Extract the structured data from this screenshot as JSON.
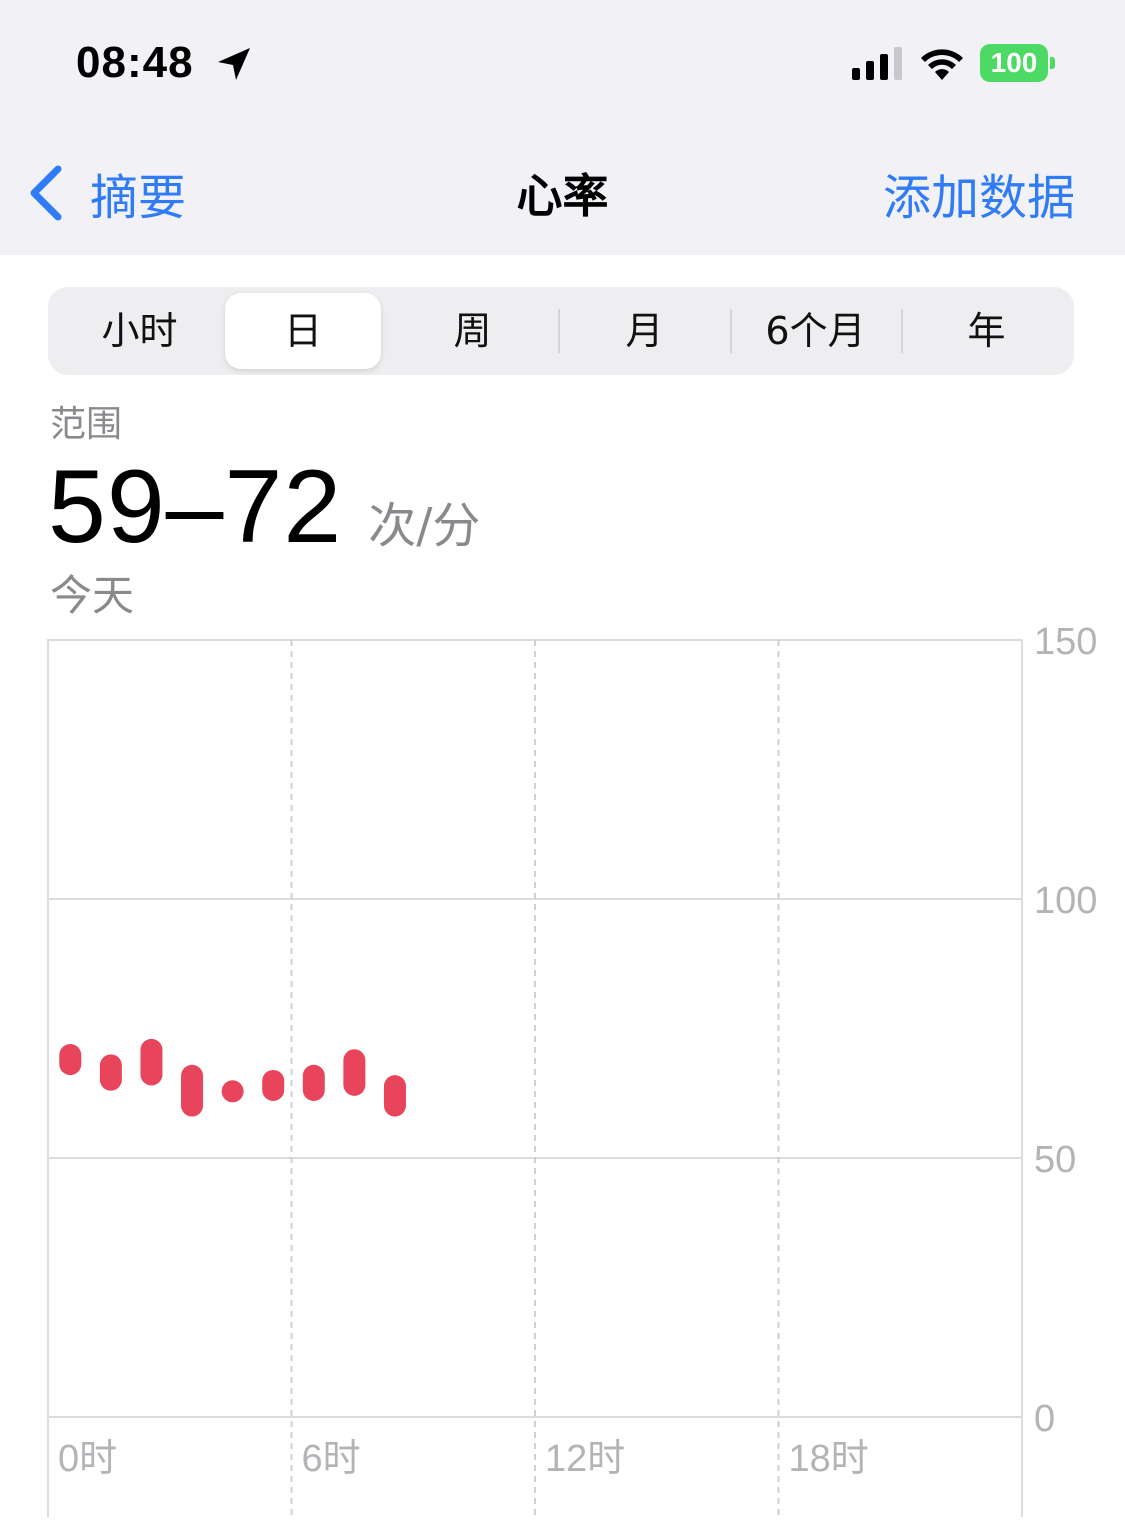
{
  "status_bar": {
    "time": "08:48",
    "location_icon": "location-arrow-icon",
    "signal_icon": "cellular-signal-icon",
    "wifi_icon": "wifi-icon",
    "battery": "100",
    "battery_color": "#4cd964"
  },
  "nav": {
    "back_label": "摘要",
    "title": "心率",
    "add_label": "添加数据",
    "accent": "#2f7cf6"
  },
  "segments": {
    "items": [
      "小时",
      "日",
      "周",
      "月",
      "6个月",
      "年"
    ],
    "selected": "日"
  },
  "summary": {
    "label": "范围",
    "value": "59–72",
    "unit": "次/分",
    "date": "今天"
  },
  "chart_data": {
    "type": "bar",
    "subtype": "range",
    "color": "#e8455c",
    "x_unit": "hour",
    "x_range": [
      0,
      24
    ],
    "x_tick_values": [
      0,
      6,
      12,
      18
    ],
    "x_tick_labels": [
      "0时",
      "6时",
      "12时",
      "18时"
    ],
    "y_range": [
      0,
      150
    ],
    "y_tick_values": [
      150,
      100,
      50,
      0
    ],
    "y_tick_labels": [
      "150",
      "100",
      "50",
      "0"
    ],
    "grid": true,
    "series": [
      {
        "points": [
          {
            "x": 0.5,
            "low": 66,
            "high": 72
          },
          {
            "x": 1.5,
            "low": 63,
            "high": 70
          },
          {
            "x": 2.5,
            "low": 64,
            "high": 73
          },
          {
            "x": 3.5,
            "low": 58,
            "high": 68
          },
          {
            "x": 4.5,
            "low": 61,
            "high": 65
          },
          {
            "x": 5.5,
            "low": 61,
            "high": 67
          },
          {
            "x": 6.5,
            "low": 61,
            "high": 68
          },
          {
            "x": 7.5,
            "low": 62,
            "high": 71
          },
          {
            "x": 8.5,
            "low": 58,
            "high": 66
          }
        ]
      }
    ]
  }
}
